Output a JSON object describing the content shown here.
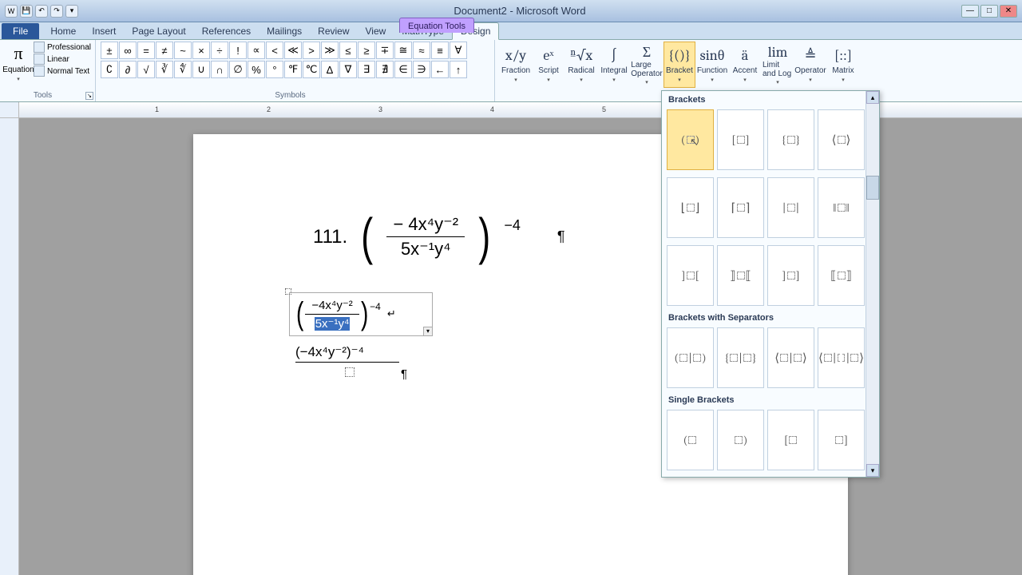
{
  "window": {
    "title": "Document2 - Microsoft Word",
    "context_tab": "Equation Tools"
  },
  "tabs": {
    "file": "File",
    "items": [
      "Home",
      "Insert",
      "Page Layout",
      "References",
      "Mailings",
      "Review",
      "View",
      "MathType",
      "Design"
    ],
    "active": "Design"
  },
  "groups": {
    "tools": {
      "label": "Tools",
      "equation_btn": "Equation",
      "professional": "Professional",
      "linear": "Linear",
      "normal_text": "Normal Text"
    },
    "symbols": {
      "label": "Symbols",
      "row1": [
        "±",
        "∞",
        "=",
        "≠",
        "~",
        "×",
        "÷",
        "!",
        "∝",
        "<",
        "≪",
        ">",
        "≫",
        "≤",
        "≥",
        "∓",
        "≅",
        "≈",
        "≡",
        "∀"
      ],
      "row2": [
        "∁",
        "∂",
        "√",
        "∛",
        "∜",
        "∪",
        "∩",
        "∅",
        "%",
        "°",
        "℉",
        "℃",
        "∆",
        "∇",
        "∃",
        "∄",
        "∈",
        "∋",
        "←",
        "↑"
      ]
    },
    "structures": {
      "items": [
        {
          "id": "fraction",
          "label": "Fraction",
          "icon": "x/y"
        },
        {
          "id": "script",
          "label": "Script",
          "icon": "eˣ"
        },
        {
          "id": "radical",
          "label": "Radical",
          "icon": "ⁿ√x"
        },
        {
          "id": "integral",
          "label": "Integral",
          "icon": "∫"
        },
        {
          "id": "large-operator",
          "label": "Large Operator",
          "icon": "Σ"
        },
        {
          "id": "bracket",
          "label": "Bracket",
          "icon": "{()}"
        },
        {
          "id": "function",
          "label": "Function",
          "icon": "sinθ"
        },
        {
          "id": "accent",
          "label": "Accent",
          "icon": "ä"
        },
        {
          "id": "limit-log",
          "label": "Limit and Log",
          "icon": "lim"
        },
        {
          "id": "operator",
          "label": "Operator",
          "icon": "≜"
        },
        {
          "id": "matrix",
          "label": "Matrix",
          "icon": "[::]"
        }
      ],
      "active": "bracket"
    }
  },
  "gallery": {
    "section1": "Brackets",
    "section2": "Brackets with Separators",
    "section3": "Single Brackets",
    "row1": [
      "(□)",
      "[□]",
      "{□}",
      "⟨□⟩"
    ],
    "row2": [
      "⌊□⌋",
      "⌈□⌉",
      "|□|",
      "‖□‖"
    ],
    "row3": [
      "]□[",
      "⟧□⟦",
      "]□]",
      "⟦□⟧"
    ],
    "sep": [
      "(□|□)",
      "{□|□}",
      "⟨□|□⟩",
      "⟨□|□|□⟩"
    ],
    "single": [
      "(□",
      "□)",
      "[□",
      "□]"
    ]
  },
  "document": {
    "eq1": {
      "number": "111.",
      "numer": "− 4x⁴y⁻²",
      "denom": "5x⁻¹y⁴",
      "outer_exp": "−4"
    },
    "eq2": {
      "numer": "−4x⁴y⁻²",
      "denom_sel": "5x⁻¹y⁴",
      "outer_exp": "−4"
    },
    "eq3": {
      "text": "(−4x⁴y⁻²)⁻⁴"
    }
  },
  "ruler": {
    "marks": [
      "1",
      "2",
      "3",
      "4",
      "5"
    ]
  }
}
